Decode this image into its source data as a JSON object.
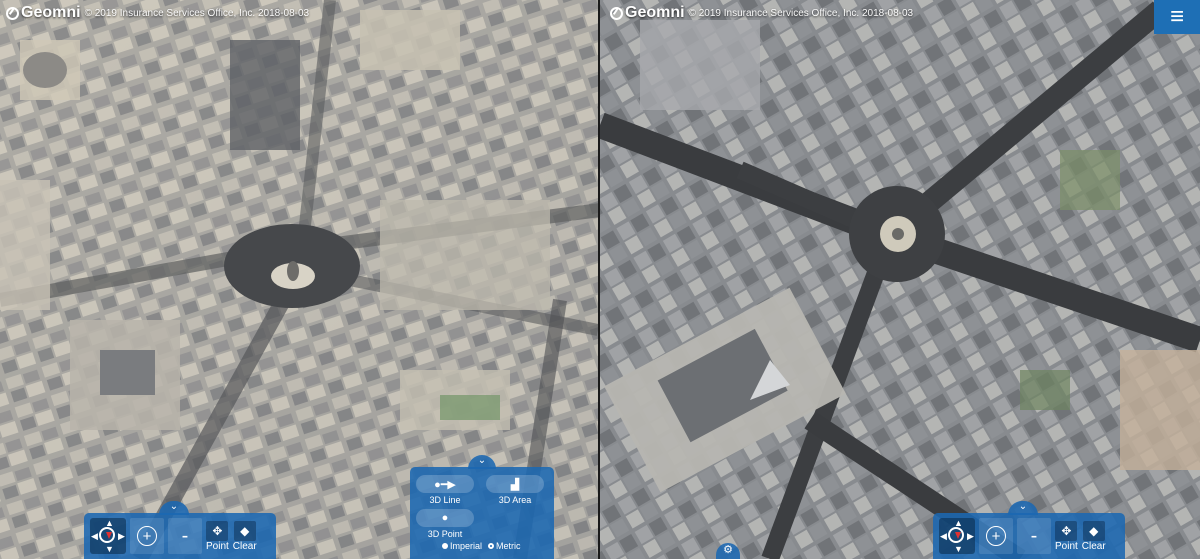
{
  "left_view": {
    "brand": "Geomni",
    "copyright": "© 2019 Insurance Services Office, Inc. 2018-08-03",
    "toolbar": {
      "zoom_in": "+",
      "zoom_out": "-",
      "point_label": "Point",
      "clear_label": "Clear"
    }
  },
  "right_view": {
    "brand": "Geomni",
    "copyright": "© 2019 Insurance Services Office, Inc. 2018-08-03",
    "menu_icon": "≡",
    "toolbar": {
      "zoom_in": "+",
      "zoom_out": "-",
      "point_label": "Point",
      "clear_label": "Clear"
    }
  },
  "measure_panel": {
    "line_label": "3D Line",
    "area_label": "3D Area",
    "point_label": "3D Point",
    "units": [
      {
        "label": "Imperial",
        "selected": false
      },
      {
        "label": "Metric",
        "selected": true
      }
    ]
  },
  "colors": {
    "toolbar_blue": "#1b68b2",
    "menu_blue": "#1e6fb5"
  }
}
